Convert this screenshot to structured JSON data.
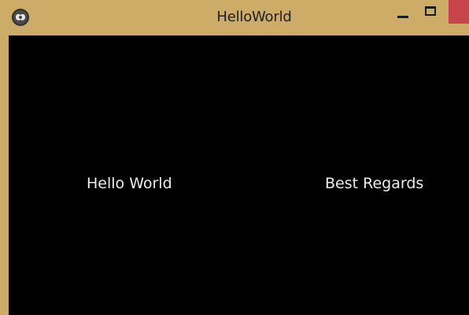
{
  "window": {
    "title": "HelloWorld",
    "titlebar_color": "#cdac68",
    "close_button_color": "#c7454a",
    "app_icon": "qt-app-icon"
  },
  "controls": {
    "minimize_icon": "minimize-icon",
    "maximize_icon": "maximize-icon",
    "close_icon": "close-icon"
  },
  "content": {
    "background": "#000000",
    "left_label": "Hello World",
    "right_label": "Best Regards"
  }
}
